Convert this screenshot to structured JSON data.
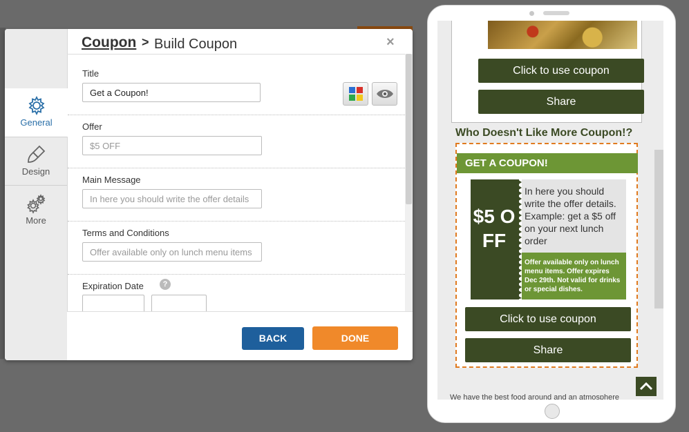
{
  "dialog": {
    "breadcrumb": {
      "link": "Coupon",
      "separator": ">",
      "current": "Build Coupon"
    },
    "close_icon": "×",
    "sidebar": [
      {
        "label": "General",
        "icon": "gear-icon",
        "active": true
      },
      {
        "label": "Design",
        "icon": "brush-icon",
        "active": false
      },
      {
        "label": "More",
        "icon": "gears-icon",
        "active": false
      }
    ],
    "fields": {
      "title": {
        "label": "Title",
        "value": "Get a Coupon!"
      },
      "offer": {
        "label": "Offer",
        "placeholder": "$5 OFF"
      },
      "main_message": {
        "label": "Main Message",
        "placeholder": "In here you should write the offer details"
      },
      "terms": {
        "label": "Terms and Conditions",
        "placeholder": "Offer available only on lunch menu items"
      },
      "expiration": {
        "label": "Expiration Date",
        "help": "?"
      }
    },
    "buttons": {
      "back": "BACK",
      "done": "DONE"
    }
  },
  "preview": {
    "buttons": {
      "use": "Click to use coupon",
      "share": "Share"
    },
    "section_title": "Who Doesn't Like More Coupon!?",
    "coupon": {
      "banner": "GET A COUPON!",
      "amount": "$5 OFF",
      "message": "In here you should write the offer details. Example: get a $5 off on your next lunch order",
      "terms": "Offer available only on lunch menu items. Offer expires Dec 29th. Not valid for drinks or special dishes."
    },
    "footer_text": "We have the best food around and an atmosphere"
  },
  "colors": {
    "accent_blue": "#1e5f9c",
    "accent_orange": "#f0892a",
    "coupon_dark": "#3b4a24",
    "coupon_green": "#6d9635",
    "dashed_border": "#e07a1f"
  }
}
